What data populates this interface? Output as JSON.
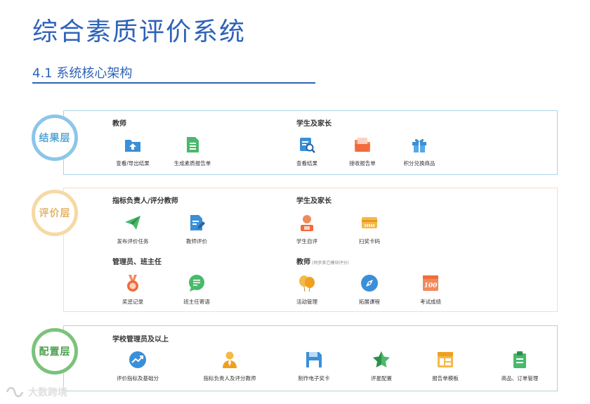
{
  "title": "综合素质评价系统",
  "subtitle": "4.1 系统核心架构",
  "watermark": "大数跨境",
  "layers": [
    {
      "name": "结果层",
      "groups": [
        {
          "title": "教师",
          "items": [
            {
              "label": "查看/导出结果",
              "icon": "folder-upload-icon"
            },
            {
              "label": "生成素质报告单",
              "icon": "document-list-icon"
            }
          ]
        },
        {
          "title": "学生及家长",
          "items": [
            {
              "label": "查看结果",
              "icon": "document-search-icon"
            },
            {
              "label": "接收报告单",
              "icon": "folder-receive-icon"
            },
            {
              "label": "积分兑换商品",
              "icon": "gift-icon"
            }
          ]
        }
      ]
    },
    {
      "name": "评价层",
      "groups": [
        {
          "title": "指标负责人/评分教师",
          "items": [
            {
              "label": "发布评价任务",
              "icon": "paper-plane-icon"
            },
            {
              "label": "教师评价",
              "icon": "document-edit-icon"
            }
          ]
        },
        {
          "title": "学生及家长",
          "items": [
            {
              "label": "学生自评",
              "icon": "student-icon"
            },
            {
              "label": "扫奖卡码",
              "icon": "card-scan-icon"
            }
          ]
        },
        {
          "title": "管理员、班主任",
          "items": [
            {
              "label": "奖惩记录",
              "icon": "medal-icon"
            },
            {
              "label": "班主任寄语",
              "icon": "chat-bubble-icon"
            }
          ]
        },
        {
          "title": "教师",
          "note": "(同步其它模块评分)",
          "items": [
            {
              "label": "活动管理",
              "icon": "balloons-icon"
            },
            {
              "label": "拓展课程",
              "icon": "compass-icon"
            },
            {
              "label": "考试成绩",
              "icon": "score-100-icon"
            }
          ]
        }
      ]
    },
    {
      "name": "配置层",
      "groups": [
        {
          "title": "学校管理员及以上",
          "items": [
            {
              "label": "评价指标及基础分",
              "icon": "trend-chart-icon"
            },
            {
              "label": "指标负责人及评分教师",
              "icon": "person-tie-icon"
            },
            {
              "label": "制作电子奖卡",
              "icon": "floppy-disk-icon"
            },
            {
              "label": "评星配置",
              "icon": "star-icon"
            },
            {
              "label": "报告单模板",
              "icon": "template-icon"
            },
            {
              "label": "商品、订单管理",
              "icon": "clipboard-icon"
            }
          ]
        }
      ]
    }
  ]
}
